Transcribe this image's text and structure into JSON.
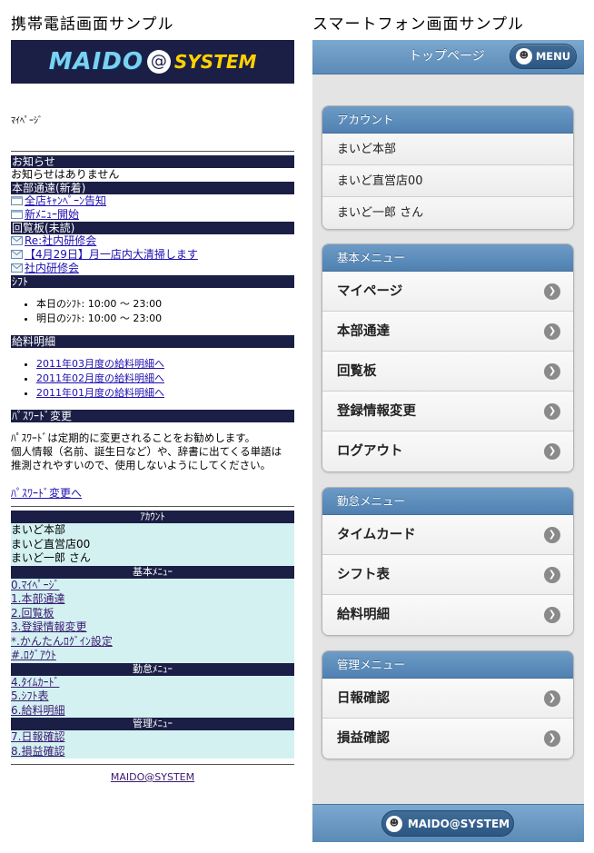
{
  "headings": {
    "left": "携帯電話画面サンプル",
    "right": "スマートフォン画面サンプル"
  },
  "feature_phone": {
    "logo": {
      "main": "MAIDO",
      "at": "@",
      "system": "SYSTEM"
    },
    "page_title": "ﾏｲﾍﾟｰｼﾞ",
    "notice": {
      "title": "お知らせ",
      "text": "お知らせはありません"
    },
    "hq": {
      "title": "本部通達(新着)",
      "items": [
        "全店ｷｬﾝﾍﾟｰﾝ告知",
        "新ﾒﾆｭｰ開始"
      ]
    },
    "board": {
      "title": "回覧板(未読)",
      "items": [
        "Re:社内研修会",
        "【4月29日】月一店内大清掃します",
        "社内研修会"
      ]
    },
    "shift": {
      "title": "ｼﾌﾄ",
      "items": [
        "本日のｼﾌﾄ: 10:00 ～ 23:00",
        "明日のｼﾌﾄ: 10:00 ～ 23:00"
      ]
    },
    "salary": {
      "title": "給料明細",
      "items": [
        "2011年03月度の給料明細へ",
        "2011年02月度の給料明細へ",
        "2011年01月度の給料明細へ"
      ]
    },
    "password": {
      "title": "ﾊﾟｽﾜｰﾄﾞ変更",
      "lines": [
        "ﾊﾟｽﾜｰﾄﾞは定期的に変更されることをお勧めします。",
        "個人情報（名前、誕生日など）や、辞書に出てくる単語は",
        "推測されやすいので、使用しないようにしてください。"
      ],
      "link": "ﾊﾟｽﾜｰﾄﾞ変更へ"
    },
    "menu": {
      "account": {
        "title": "ｱｶｳﾝﾄ",
        "items": [
          "まいど本部",
          "まいど直営店00",
          "まいど一郎 さん"
        ]
      },
      "basic": {
        "title": "基本ﾒﾆｭｰ",
        "items": [
          "0.ﾏｲﾍﾟｰｼﾞ",
          "1.本部通達",
          "2.回覧板",
          "3.登録情報変更",
          "*.かんたんﾛｸﾞｲﾝ設定",
          "#.ﾛｸﾞｱｳﾄ"
        ]
      },
      "attendance": {
        "title": "勤怠ﾒﾆｭｰ",
        "items": [
          "4.ﾀｲﾑｶｰﾄﾞ",
          "5.ｼﾌﾄ表",
          "6.給料明細"
        ]
      },
      "admin": {
        "title": "管理ﾒﾆｭｰ",
        "items": [
          "7.日報確認",
          "8.損益確認"
        ]
      }
    },
    "footer": "MAIDO@SYSTEM"
  },
  "smartphone": {
    "header": {
      "title": "トップページ",
      "menu_button": "MENU"
    },
    "account": {
      "title": "アカウント",
      "items": [
        "まいど本部",
        "まいど直営店00",
        "まいど一郎 さん"
      ]
    },
    "basic": {
      "title": "基本メニュー",
      "items": [
        "マイページ",
        "本部通達",
        "回覧板",
        "登録情報変更",
        "ログアウト"
      ]
    },
    "attendance": {
      "title": "勤怠メニュー",
      "items": [
        "タイムカード",
        "シフト表",
        "給料明細"
      ]
    },
    "admin": {
      "title": "管理メニュー",
      "items": [
        "日報確認",
        "損益確認"
      ]
    },
    "footer_button": "MAIDO@SYSTEM"
  },
  "icons": {
    "memo": "memo-icon",
    "mail": "envelope-icon",
    "arrow": "chevron-right-icon",
    "logo": "maido-mascot-icon"
  },
  "colors": {
    "fp_bar": "#1b1e45",
    "fp_menu_bg": "#d4f1f1",
    "sp_header": "#5a8ab6",
    "sp_bg": "#e4e4e4"
  }
}
